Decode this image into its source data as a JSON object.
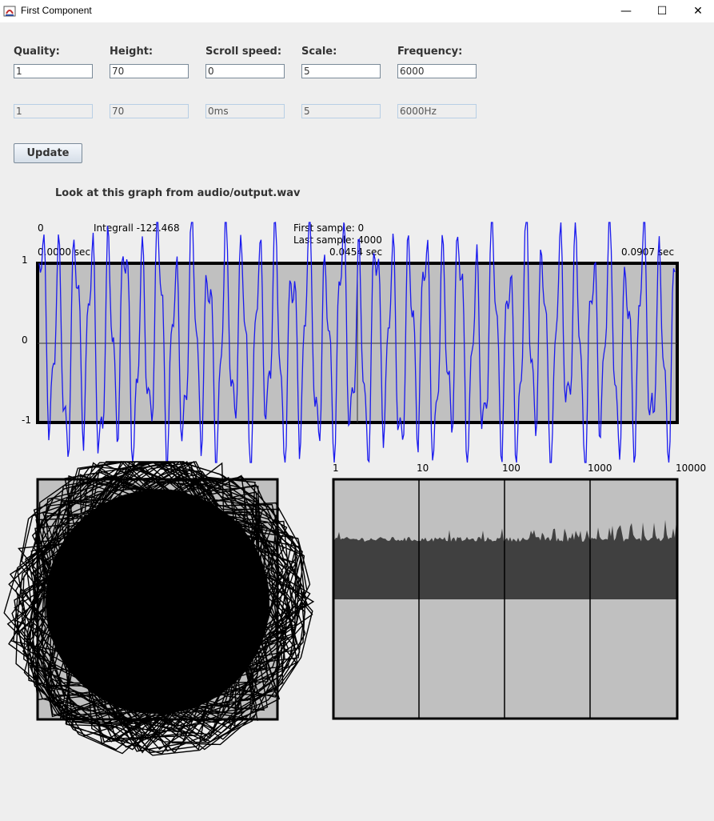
{
  "window": {
    "title": "First Component",
    "minimize": "—",
    "maximize": "☐",
    "close": "✕"
  },
  "fields": [
    {
      "label": "Quality:",
      "value": "1",
      "display": "1"
    },
    {
      "label": "Height:",
      "value": "70",
      "display": "70"
    },
    {
      "label": "Scroll speed:",
      "value": "0",
      "display": "0ms"
    },
    {
      "label": "Scale:",
      "value": "5",
      "display": "5"
    },
    {
      "label": "Frequency:",
      "value": "6000",
      "display": "6000Hz"
    }
  ],
  "update_label": "Update",
  "caption": "Look at this graph from audio/output.wav",
  "waveform": {
    "start_index": "0",
    "integral": "Integrall -122.468",
    "first_sample": "First sample: 0",
    "last_sample": "Last sample: 4000",
    "time_labels": [
      "0.0000 sec",
      "0.0454 sec",
      "0.0907 sec"
    ],
    "y_labels": [
      "1",
      "0",
      "-1"
    ]
  },
  "spectrum": {
    "x_labels": [
      "1",
      "10",
      "100",
      "1000",
      "10000"
    ]
  },
  "colors": {
    "wave": "#1a1aee",
    "plot_bg": "#c0c0c0",
    "spectrum_fill": "#404040",
    "window_bg": "#eeeeee"
  }
}
